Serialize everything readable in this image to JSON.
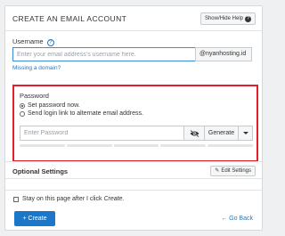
{
  "header": {
    "title": "CREATE AN EMAIL ACCOUNT",
    "help_label": "Show/Hide Help",
    "help_icon": "?"
  },
  "username": {
    "label": "Username",
    "info_icon": "?",
    "placeholder": "Enter your email address’s username here.",
    "value": "",
    "domain": "@nyanhosting.id",
    "missing_domain": "Missing a domain?"
  },
  "password": {
    "label": "Password",
    "options": [
      {
        "label": "Set password now.",
        "selected": true
      },
      {
        "label": "Send login link to alternate email address.",
        "selected": false
      }
    ],
    "placeholder": "Enter Password",
    "generate_label": "Generate",
    "highlight_color": "#e0212b"
  },
  "optional": {
    "title": "Optional Settings",
    "edit_label": "Edit Settings"
  },
  "footer": {
    "stay_label": "Stay on this page after I click ",
    "stay_emphasis": "Create.",
    "create_label": "+ Create",
    "back_label": "← Go Back",
    "accent": "#1d77c8"
  }
}
